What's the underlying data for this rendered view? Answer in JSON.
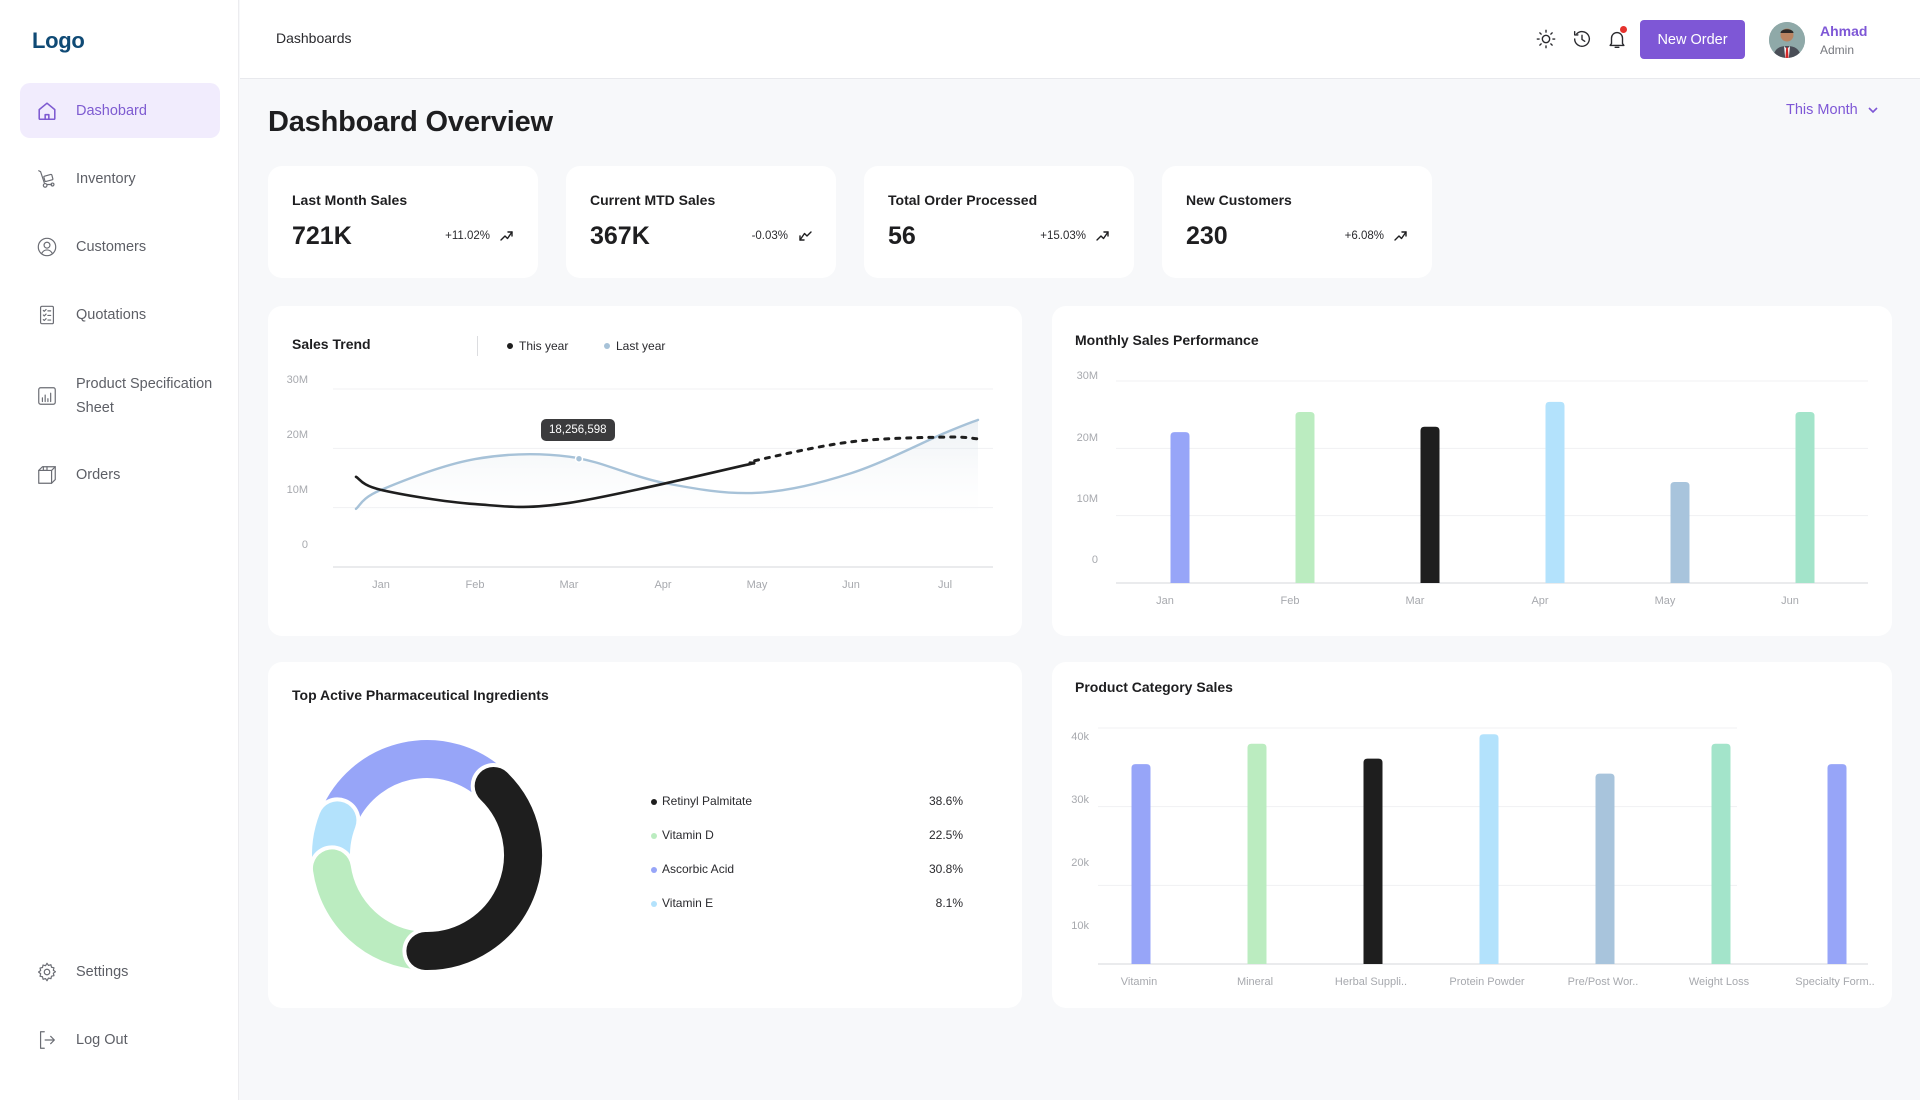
{
  "app": {
    "logo": "Logo"
  },
  "sidebar": {
    "items": [
      {
        "label": "Dashobard",
        "icon": "home-icon",
        "active": true
      },
      {
        "label": "Inventory",
        "icon": "hand-truck-icon"
      },
      {
        "label": "Customers",
        "icon": "user-circle-icon"
      },
      {
        "label": "Quotations",
        "icon": "checklist-icon"
      },
      {
        "label": "Product Specification Sheet",
        "icon": "bar-chart-icon"
      },
      {
        "label": "Orders",
        "icon": "box-icon"
      }
    ],
    "bottom": [
      {
        "label": "Settings",
        "icon": "gear-icon"
      },
      {
        "label": "Log Out",
        "icon": "logout-icon"
      }
    ]
  },
  "header": {
    "breadcrumb": "Dashboards",
    "icons": [
      "sun-icon",
      "history-icon",
      "bell-icon"
    ],
    "has_notification": true,
    "new_order_label": "New Order",
    "user": {
      "name": "Ahmad",
      "role": "Admin"
    }
  },
  "page": {
    "title": "Dashboard Overview",
    "period": "This Month"
  },
  "stats": [
    {
      "title": "Last Month Sales",
      "value": "721K",
      "change": "+11.02%",
      "direction": "up"
    },
    {
      "title": "Current MTD Sales",
      "value": "367K",
      "change": "-0.03%",
      "direction": "down"
    },
    {
      "title": "Total Order Processed",
      "value": "56",
      "change": "+15.03%",
      "direction": "up"
    },
    {
      "title": "New Customers",
      "value": "230",
      "change": "+6.08%",
      "direction": "up"
    }
  ],
  "colors": {
    "accent": "#7e57d6",
    "this_year": "#1e1e1e",
    "last_year": "#a7c2d8",
    "palette": [
      "#97a5f8",
      "#bbecc0",
      "#1e1e1e",
      "#b3e2fc",
      "#a8c4dc",
      "#a3e4ca"
    ]
  },
  "chart_data": [
    {
      "type": "line",
      "title": "Sales Trend",
      "categories": [
        "Jan",
        "Feb",
        "Mar",
        "Apr",
        "May",
        "Jun",
        "Jul"
      ],
      "yticks": [
        "30M",
        "20M",
        "10M",
        "0"
      ],
      "ylim": [
        0,
        30000000
      ],
      "series": [
        {
          "name": "This year",
          "values": [
            13.0,
            10.6,
            10.8,
            13.0,
            18.0,
            21.1,
            21.9
          ],
          "unit": "M",
          "forecast_from_index": 4
        },
        {
          "name": "Last year",
          "values": [
            13.0,
            18.2,
            18.6,
            14.2,
            12.5,
            15.8,
            22.6
          ],
          "unit": "M"
        }
      ],
      "tooltip": {
        "series": "Last year",
        "label": "18,256,598"
      },
      "legend": "top"
    },
    {
      "type": "bar",
      "title": "Monthly Sales Performance",
      "categories": [
        "Jan",
        "Feb",
        "Mar",
        "Apr",
        "May",
        "Jun"
      ],
      "values": [
        22.4,
        25.4,
        23.2,
        26.9,
        15.0,
        25.4
      ],
      "unit": "M",
      "yticks": [
        "30M",
        "20M",
        "10M",
        "0"
      ],
      "ylim": [
        0,
        30
      ]
    },
    {
      "type": "pie",
      "title": "Top Active Pharmaceutical Ingredients",
      "slices": [
        {
          "label": "Retinyl Palmitate",
          "value": 38.6,
          "display": "38.6%",
          "color": "#1e1e1e"
        },
        {
          "label": "Vitamin D",
          "value": 22.5,
          "display": "22.5%",
          "color": "#bbecc0"
        },
        {
          "label": "Ascorbic Acid",
          "value": 30.8,
          "display": "30.8%",
          "color": "#97a5f8"
        },
        {
          "label": "Vitamin E",
          "value": 8.1,
          "display": "8.1%",
          "color": "#b3e2fc"
        }
      ],
      "draw_order": [
        0,
        1,
        3,
        2
      ]
    },
    {
      "type": "bar",
      "title": "Product Category Sales",
      "categories": [
        "Vitamin",
        "Mineral",
        "Herbal Suppli..",
        "Protein Powder",
        "Pre/Post Wor..",
        "Weight Loss",
        "Specialty Form.."
      ],
      "values": [
        35.4,
        38.0,
        36.1,
        39.2,
        34.2,
        38.0,
        35.4
      ],
      "unit": "k",
      "yticks": [
        "40k",
        "30k",
        "20k",
        "10k"
      ],
      "ylim": [
        10,
        40
      ]
    }
  ]
}
